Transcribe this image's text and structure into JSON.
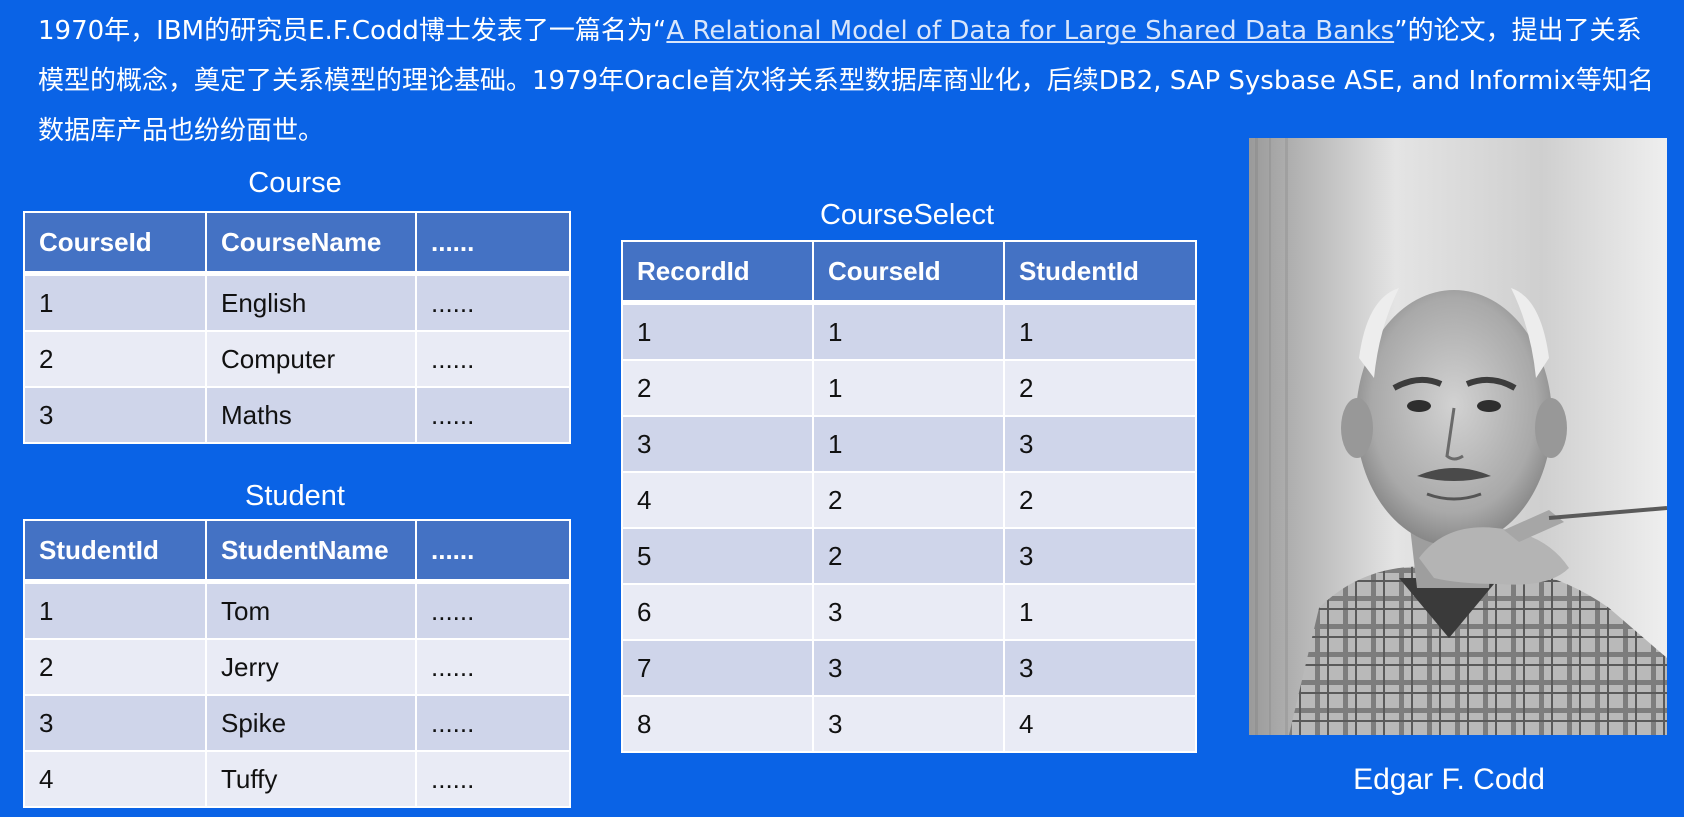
{
  "intro": {
    "before": "1970年，IBM的研究员E.F.Codd博士发表了一篇名为“",
    "paper_title": "A Relational Model of Data for Large Shared Data Banks",
    "after": "”的论文，提出了关系模型的概念，奠定了关系模型的理论基础。1979年Oracle首次将关系型数据库商业化，后续DB2, SAP Sysbase ASE, and Informix等知名数据库产品也纷纷面世。"
  },
  "course": {
    "title": "Course",
    "headers": [
      "CourseId",
      "CourseName",
      "......"
    ],
    "rows": [
      [
        "1",
        "English",
        "......"
      ],
      [
        "2",
        "Computer",
        "......"
      ],
      [
        "3",
        "Maths",
        "......"
      ]
    ]
  },
  "student": {
    "title": "Student",
    "headers": [
      "StudentId",
      "StudentName",
      "......"
    ],
    "rows": [
      [
        "1",
        "Tom",
        "......"
      ],
      [
        "2",
        "Jerry",
        "......"
      ],
      [
        "3",
        "Spike",
        "......"
      ],
      [
        "4",
        "Tuffy",
        "......"
      ]
    ]
  },
  "course_select": {
    "title": "CourseSelect",
    "headers": [
      "RecordId",
      "CourseId",
      "StudentId"
    ],
    "rows": [
      [
        "1",
        "1",
        "1"
      ],
      [
        "2",
        "1",
        "2"
      ],
      [
        "3",
        "1",
        "3"
      ],
      [
        "4",
        "2",
        "2"
      ],
      [
        "5",
        "2",
        "3"
      ],
      [
        "6",
        "3",
        "1"
      ],
      [
        "7",
        "3",
        "3"
      ],
      [
        "8",
        "3",
        "4"
      ]
    ]
  },
  "photo": {
    "caption": "Edgar F. Codd"
  },
  "colors": {
    "background": "#0a63e6",
    "table_header": "#4472c4",
    "row_odd": "#cfd5ea",
    "row_even": "#e9ebf5"
  }
}
